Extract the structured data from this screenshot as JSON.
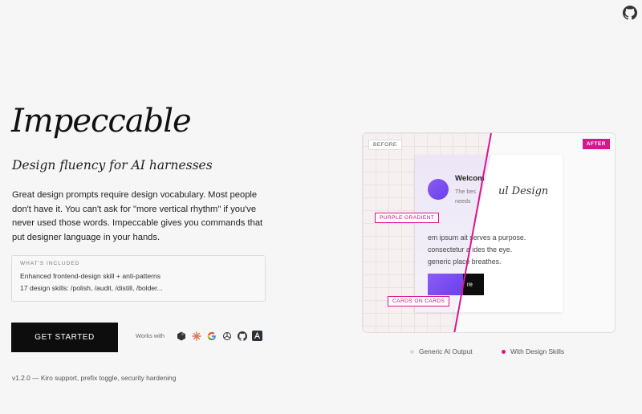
{
  "hero": {
    "title": "Impeccable",
    "subtitle": "Design fluency for AI harnesses",
    "intro": "Great design prompts require design vocabulary. Most people don't have it. You can't ask for \"more vertical rhythm\" if you've never used those words. Impeccable gives you commands that put designer language in your hands."
  },
  "included": {
    "label": "WHAT'S INCLUDED",
    "items": [
      "Enhanced frontend-design skill + anti-patterns",
      "17 design skills: /polish, /audit, /distill, /bolder..."
    ]
  },
  "cta": {
    "label": "GET STARTED"
  },
  "works_with": {
    "label": "Works with",
    "icons": [
      "cursor-icon",
      "claude-icon",
      "google-gemini-icon",
      "openai-icon",
      "github-copilot-icon",
      "antigravity-icon"
    ]
  },
  "version": "v1.2.0 — Kiro support, prefix toggle, security hardening",
  "demo": {
    "tag_before": "BEFORE",
    "tag_after": "AFTER",
    "card": {
      "welcome": "Welcom",
      "sub": "The bes needs",
      "after_heading": "ul Design",
      "body_lines": [
        "em ipsum ait serves a purpose.",
        "consectetur a ides the eye.",
        "generic place breathes."
      ],
      "button": "re"
    },
    "annotations": {
      "purple_gradient": "PURPLE GRADIENT",
      "cards_on_cards": "CARDS ON CARDS"
    },
    "legend": {
      "before": "Generic AI Output",
      "after": "With Design Skills"
    }
  },
  "colors": {
    "accent": "#d8168f",
    "purple": "#7a4ff0",
    "text": "#1a1a1a",
    "background": "#f6f6f6"
  }
}
